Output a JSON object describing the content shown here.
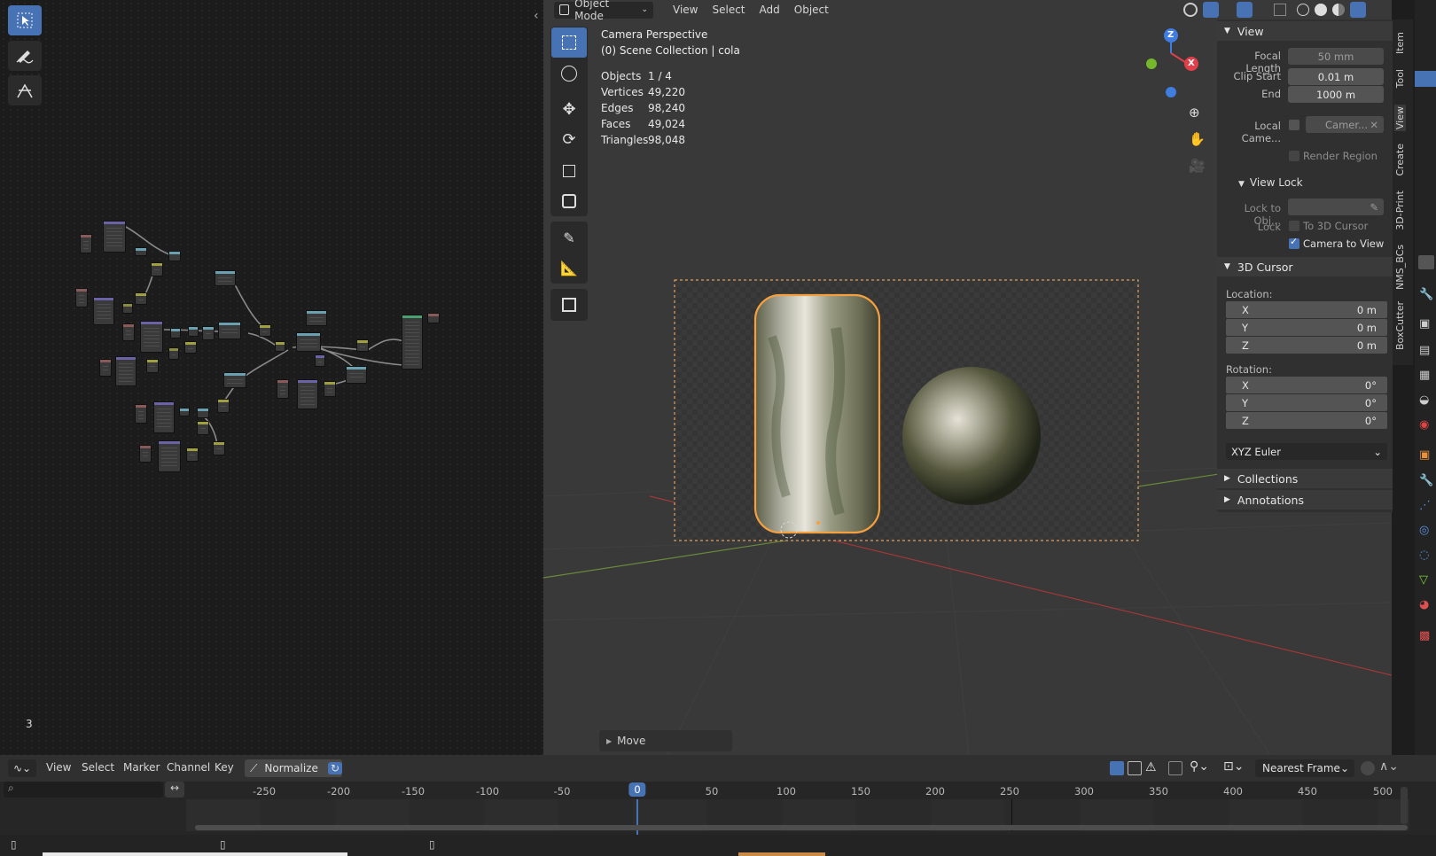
{
  "node_editor": {
    "frame_number_label": "3",
    "tools": [
      {
        "name": "select-box",
        "icon": "cursor-box-icon"
      },
      {
        "name": "annotate",
        "icon": "pencil-icon"
      },
      {
        "name": "link-cut",
        "icon": "links-cut-icon"
      }
    ]
  },
  "viewport": {
    "mode_select": "Object Mode",
    "menus": [
      "View",
      "Select",
      "Add",
      "Object"
    ],
    "overlay_title": "Camera Perspective",
    "overlay_subtitle": "(0) Scene Collection | cola",
    "stats": [
      {
        "label": "Objects",
        "value": "1 / 4"
      },
      {
        "label": "Vertices",
        "value": "49,220"
      },
      {
        "label": "Edges",
        "value": "98,240"
      },
      {
        "label": "Faces",
        "value": "49,024"
      },
      {
        "label": "Triangles",
        "value": "98,048"
      }
    ],
    "gizmo_axes": [
      "Z",
      "X"
    ],
    "last_operator": "Move"
  },
  "npanel": {
    "tabs": [
      "Item",
      "Tool",
      "View",
      "Create",
      "3D-Print",
      "NMS_BCs",
      "BoxCutter"
    ],
    "view": {
      "title": "View",
      "focal_length_label": "Focal Length",
      "focal_length": "50 mm",
      "clip_start_label": "Clip Start",
      "clip_start": "0.01 m",
      "clip_end_label": "End",
      "clip_end": "1000 m",
      "local_camera_label": "Local Came...",
      "local_camera_field": "Camer...",
      "render_region_label": "Render Region",
      "view_lock_title": "View Lock",
      "lock_to_obj_label": "Lock to Obj...",
      "lock_label": "Lock",
      "to_3d_cursor_label": "To 3D Cursor",
      "camera_to_view_label": "Camera to View",
      "camera_to_view_checked": true
    },
    "cursor": {
      "title": "3D Cursor",
      "location_label": "Location:",
      "location": [
        {
          "axis": "X",
          "value": "0 m"
        },
        {
          "axis": "Y",
          "value": "0 m"
        },
        {
          "axis": "Z",
          "value": "0 m"
        }
      ],
      "rotation_label": "Rotation:",
      "rotation": [
        {
          "axis": "X",
          "value": "0°"
        },
        {
          "axis": "Y",
          "value": "0°"
        },
        {
          "axis": "Z",
          "value": "0°"
        }
      ],
      "rotation_mode": "XYZ Euler"
    },
    "collections_title": "Collections",
    "annotations_title": "Annotations"
  },
  "timeline": {
    "menus": [
      "View",
      "Select",
      "Marker",
      "Channel",
      "Key"
    ],
    "normalize_label": "Normalize",
    "snap_mode": "Nearest Frame",
    "current_frame": "0",
    "frame_ticks": [
      "-250",
      "-200",
      "-150",
      "-100",
      "-50",
      "0",
      "50",
      "100",
      "150",
      "200",
      "250",
      "300",
      "350",
      "400",
      "450",
      "500"
    ]
  },
  "colors": {
    "accent": "#4772b3",
    "selection_outline": "#f5a040",
    "axis_x": "#e0404a",
    "axis_y": "#76b82a",
    "axis_z": "#3f7de0"
  }
}
